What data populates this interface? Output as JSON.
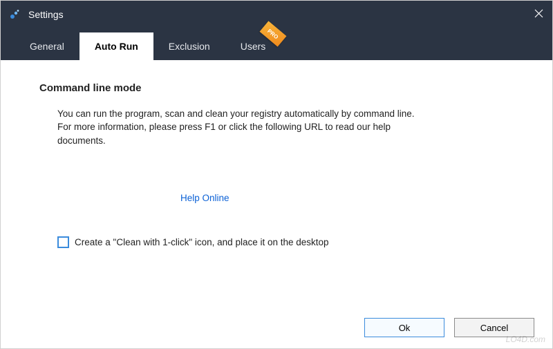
{
  "window": {
    "title": "Settings"
  },
  "tabs": {
    "general": "General",
    "autorun": "Auto Run",
    "exclusion": "Exclusion",
    "users": "Users",
    "pro_badge": "PRO"
  },
  "section": {
    "title": "Command line mode",
    "description": "You can run the program, scan and clean your registry automatically by command line. For more information, please press F1 or click the following URL to read our help documents."
  },
  "link": {
    "help_online": "Help Online"
  },
  "checkbox": {
    "label": "Create a \"Clean with 1-click\" icon, and place it on the desktop"
  },
  "buttons": {
    "ok": "Ok",
    "cancel": "Cancel"
  },
  "watermark": "   LO4D.com"
}
